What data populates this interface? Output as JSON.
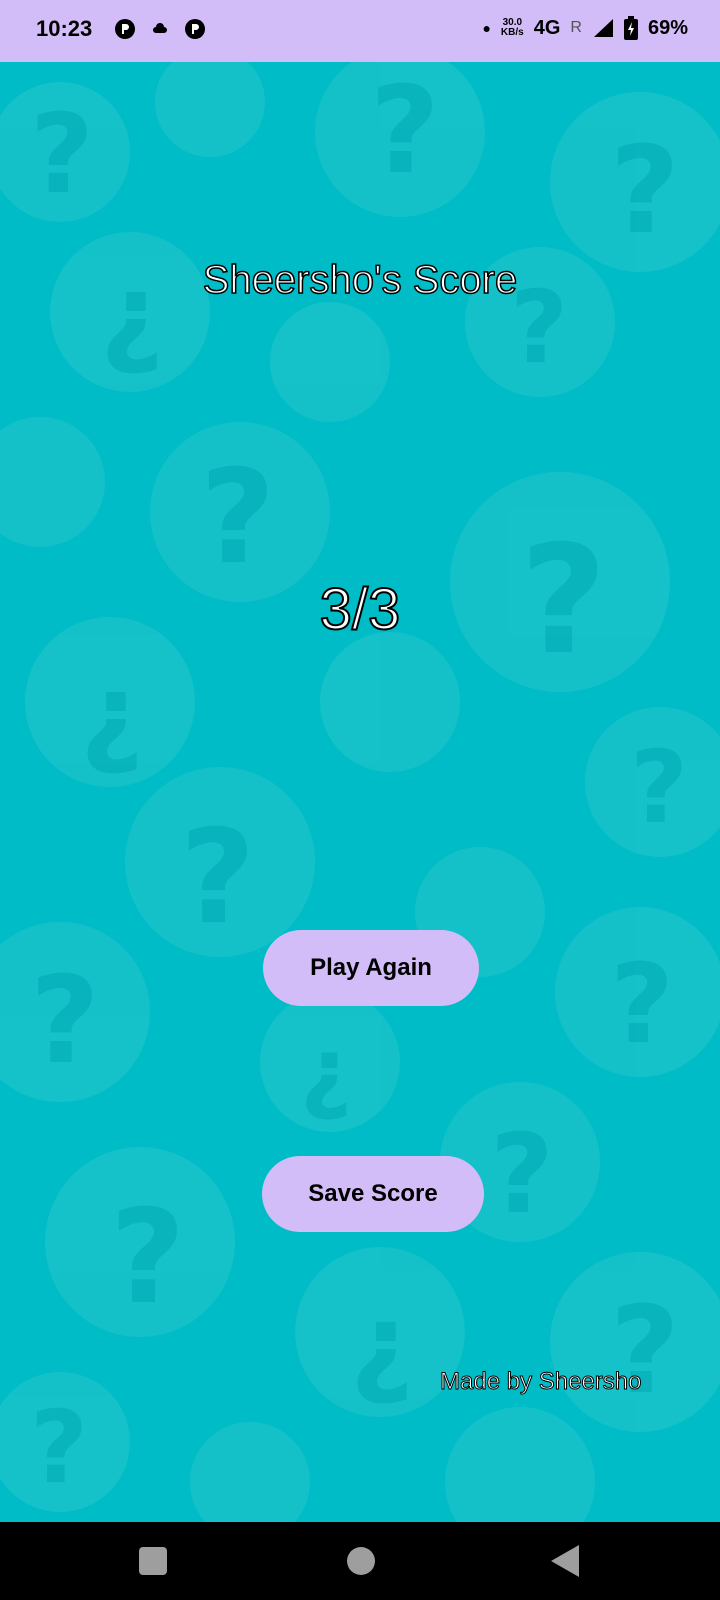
{
  "status_bar": {
    "time": "10:23",
    "speed_value": "30.0",
    "speed_unit": "KB/s",
    "network": "4G",
    "roaming": "R",
    "battery": "69%"
  },
  "main": {
    "title": "Sheersho's Score",
    "score": "3/3",
    "play_again_label": "Play Again",
    "save_score_label": "Save Score",
    "footer": "Made by Sheersho"
  },
  "colors": {
    "background": "#00bcc6",
    "accent": "#d3bdf8"
  }
}
